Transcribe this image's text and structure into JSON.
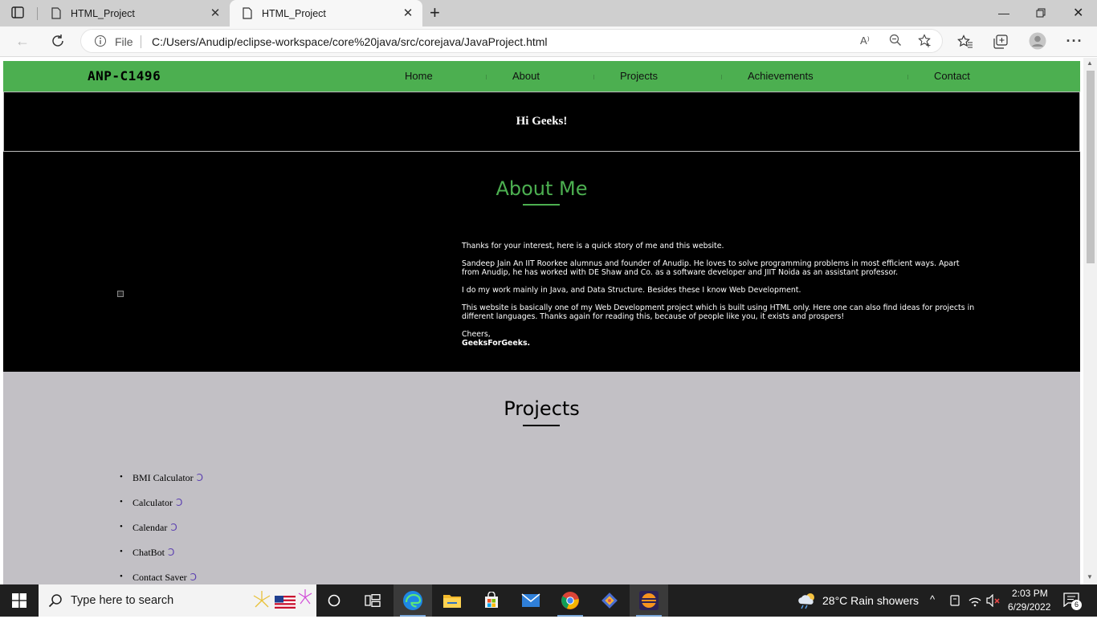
{
  "browser": {
    "tabs": [
      {
        "title": "HTML_Project",
        "active": false
      },
      {
        "title": "HTML_Project",
        "active": true
      }
    ],
    "address": {
      "scheme_label": "File",
      "url": "C:/Users/Anudip/eclipse-workspace/core%20java/src/corejava/JavaProject.html"
    }
  },
  "site": {
    "logo": "ANP-C1496",
    "nav": [
      "Home",
      "About",
      "Projects",
      "Achievements",
      "Contact"
    ],
    "hero_title": "Hi Geeks!",
    "about": {
      "heading": "About Me",
      "paragraphs": [
        "Thanks for your interest, here is a quick story of me and this website.",
        "Sandeep Jain An IIT Roorkee alumnus and founder of Anudip. He loves to solve programming problems in most efficient ways. Apart from Anudip, he has worked with DE Shaw and Co. as a software developer and JIIT Noida as an assistant professor.",
        "I do my work mainly in Java, and Data Structure. Besides these I know Web Development.",
        "This website is basically one of my Web Development project which is built using HTML only. Here one can also find ideas for projects in different languages. Thanks again for reading this, because of people like you, it exists and prospers!"
      ],
      "signoff": "Cheers,",
      "signature": "GeeksForGeeks."
    },
    "projects": {
      "heading": "Projects",
      "items": [
        "BMI Calculator",
        "Calculator",
        "Calendar",
        "ChatBot",
        "Contact Saver"
      ],
      "link_glyph": "Ↄ"
    }
  },
  "taskbar": {
    "search_placeholder": "Type here to search",
    "weather": "28°C  Rain showers",
    "time": "2:03 PM",
    "date": "6/29/2022",
    "notification_count": "6"
  },
  "colors": {
    "accent_green": "#4caf50",
    "projects_bg": "#c2c0c5",
    "link_purple": "#5b3fb0"
  }
}
